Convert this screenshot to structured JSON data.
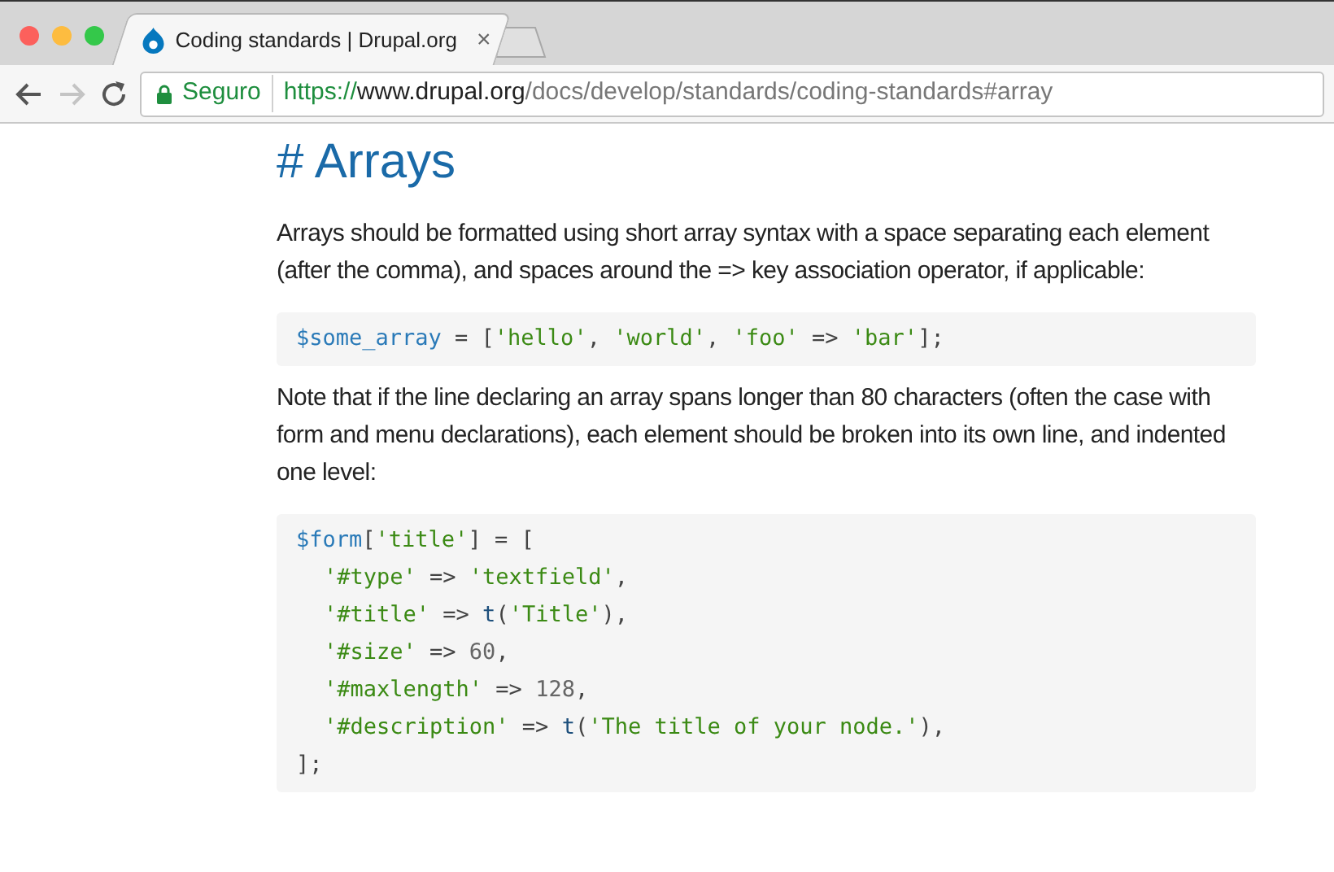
{
  "window": {
    "controls": [
      {
        "color": "#fc605c"
      },
      {
        "color": "#fdbc40"
      },
      {
        "color": "#34c84a"
      }
    ]
  },
  "tabs": [
    {
      "title": "Coding standards | Drupal.org",
      "close": "×",
      "selected": true
    }
  ],
  "toolbar": {
    "back_enabled": true,
    "forward_enabled": false,
    "security_label": "Seguro",
    "url": {
      "scheme": "https://",
      "host": "www.drupal.org",
      "path": "/docs/develop/standards/coding-standards#array"
    }
  },
  "content": [
    {
      "kind": "heading",
      "text": "# Arrays"
    },
    {
      "kind": "paragraph",
      "text": "Arrays should be formatted using short array syntax with a space separating each element (after the comma), and spaces around the => key association operator, if applicable:"
    },
    {
      "kind": "code",
      "lines": [
        {
          "indented": false,
          "tokens": [
            {
              "kind": "var",
              "s": "$some_array"
            },
            {
              "kind": "plain",
              "s": " = ["
            },
            {
              "kind": "str",
              "s": "'hello'"
            },
            {
              "kind": "plain",
              "s": ", "
            },
            {
              "kind": "str",
              "s": "'world'"
            },
            {
              "kind": "plain",
              "s": ", "
            },
            {
              "kind": "str",
              "s": "'foo'"
            },
            {
              "kind": "plain",
              "s": " => "
            },
            {
              "kind": "str",
              "s": "'bar'"
            },
            {
              "kind": "plain",
              "s": "];"
            }
          ]
        }
      ]
    },
    {
      "kind": "paragraph",
      "text": "Note that if the line declaring an array spans longer than 80 characters (often the case with form and menu declarations), each element should be broken into its own line, and indented one level:"
    },
    {
      "kind": "code",
      "lines": [
        {
          "indented": false,
          "tokens": [
            {
              "kind": "var",
              "s": "$form"
            },
            {
              "kind": "plain",
              "s": "["
            },
            {
              "kind": "str",
              "s": "'title'"
            },
            {
              "kind": "plain",
              "s": "] = ["
            }
          ]
        },
        {
          "indented": true,
          "tokens": [
            {
              "kind": "str",
              "s": "'#type'"
            },
            {
              "kind": "plain",
              "s": " => "
            },
            {
              "kind": "str",
              "s": "'textfield'"
            },
            {
              "kind": "plain",
              "s": ","
            }
          ]
        },
        {
          "indented": true,
          "tokens": [
            {
              "kind": "str",
              "s": "'#title'"
            },
            {
              "kind": "plain",
              "s": " => "
            },
            {
              "kind": "func",
              "s": "t"
            },
            {
              "kind": "plain",
              "s": "("
            },
            {
              "kind": "str",
              "s": "'Title'"
            },
            {
              "kind": "plain",
              "s": "),"
            }
          ]
        },
        {
          "indented": true,
          "tokens": [
            {
              "kind": "str",
              "s": "'#size'"
            },
            {
              "kind": "plain",
              "s": " => "
            },
            {
              "kind": "num",
              "s": "60"
            },
            {
              "kind": "plain",
              "s": ","
            }
          ]
        },
        {
          "indented": true,
          "tokens": [
            {
              "kind": "str",
              "s": "'#maxlength'"
            },
            {
              "kind": "plain",
              "s": " => "
            },
            {
              "kind": "num",
              "s": "128"
            },
            {
              "kind": "plain",
              "s": ","
            }
          ]
        },
        {
          "indented": true,
          "tokens": [
            {
              "kind": "str",
              "s": "'#description'"
            },
            {
              "kind": "plain",
              "s": " => "
            },
            {
              "kind": "func",
              "s": "t"
            },
            {
              "kind": "plain",
              "s": "("
            },
            {
              "kind": "str",
              "s": "'The title of your node.'"
            },
            {
              "kind": "plain",
              "s": "),"
            }
          ]
        },
        {
          "indented": false,
          "tokens": [
            {
              "kind": "plain",
              "s": "];"
            }
          ]
        }
      ]
    }
  ]
}
